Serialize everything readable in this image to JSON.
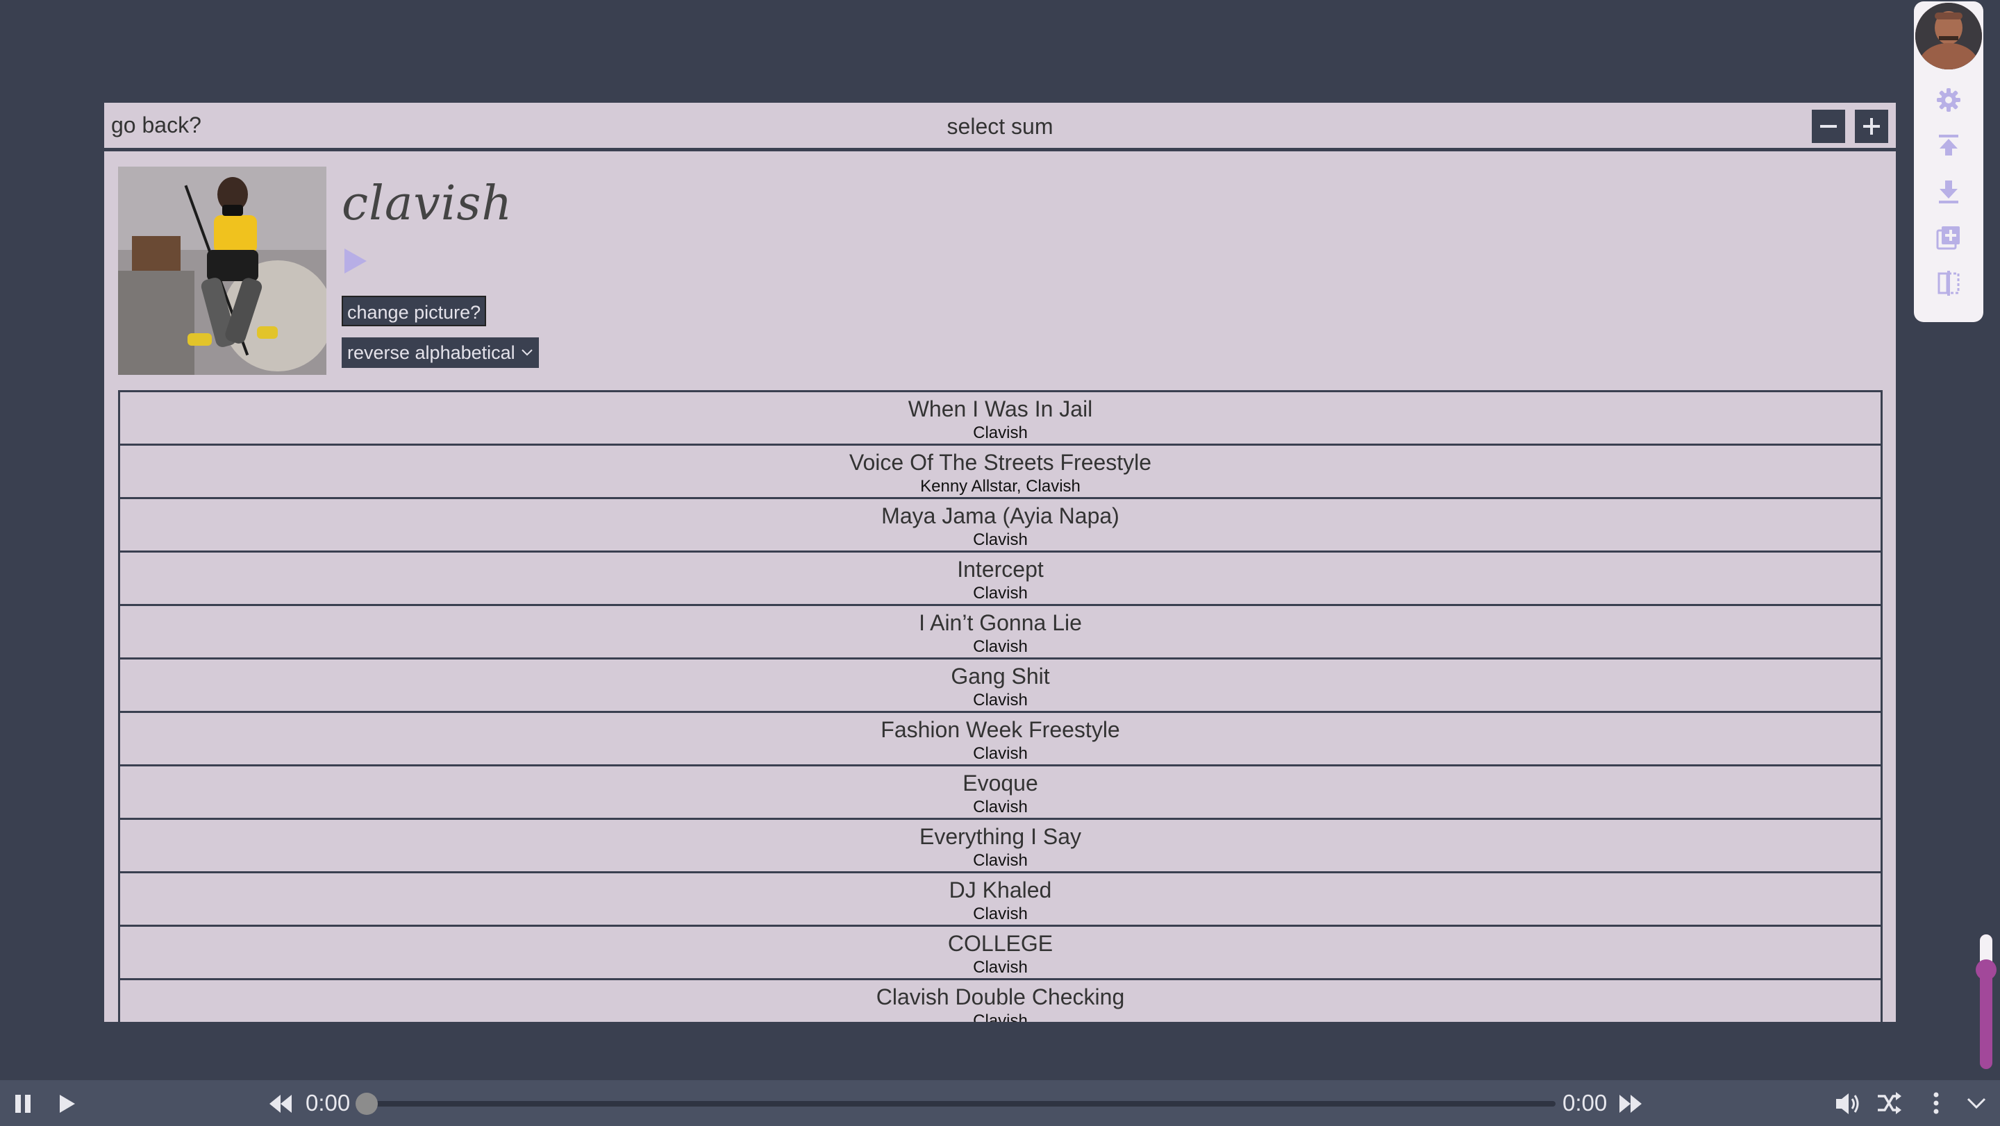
{
  "panel": {
    "go_back": "go back?",
    "title": "select sum"
  },
  "album": {
    "name": "clavish",
    "change_picture": "change picture?",
    "sort": {
      "selected": "reverse alphabetical"
    }
  },
  "tracks": [
    {
      "title": "When I Was In Jail",
      "artist": "Clavish"
    },
    {
      "title": "Voice Of The Streets Freestyle",
      "artist": "Kenny Allstar, Clavish"
    },
    {
      "title": "Maya Jama (Ayia Napa)",
      "artist": "Clavish"
    },
    {
      "title": "Intercept",
      "artist": "Clavish"
    },
    {
      "title": "I Ain’t Gonna Lie",
      "artist": "Clavish"
    },
    {
      "title": "Gang Shit",
      "artist": "Clavish"
    },
    {
      "title": "Fashion Week Freestyle",
      "artist": "Clavish"
    },
    {
      "title": "Evoque",
      "artist": "Clavish"
    },
    {
      "title": "Everything I Say",
      "artist": "Clavish"
    },
    {
      "title": "DJ Khaled",
      "artist": "Clavish"
    },
    {
      "title": "COLLEGE",
      "artist": "Clavish"
    },
    {
      "title": "Clavish Double Checking",
      "artist": "Clavish"
    }
  ],
  "player": {
    "current_time": "0:00",
    "total_time": "0:00",
    "progress": 0,
    "volume": 0.75
  },
  "sidebar": {
    "icons": [
      "settings-icon",
      "upload-icon",
      "download-icon",
      "add-playlist-icon",
      "split-view-icon"
    ]
  },
  "colors": {
    "background": "#3a4050",
    "panel": "#d5cbd7",
    "accent": "#a2489a",
    "sidebar": "#f4f1f5",
    "player_bar": "#4a5163"
  }
}
